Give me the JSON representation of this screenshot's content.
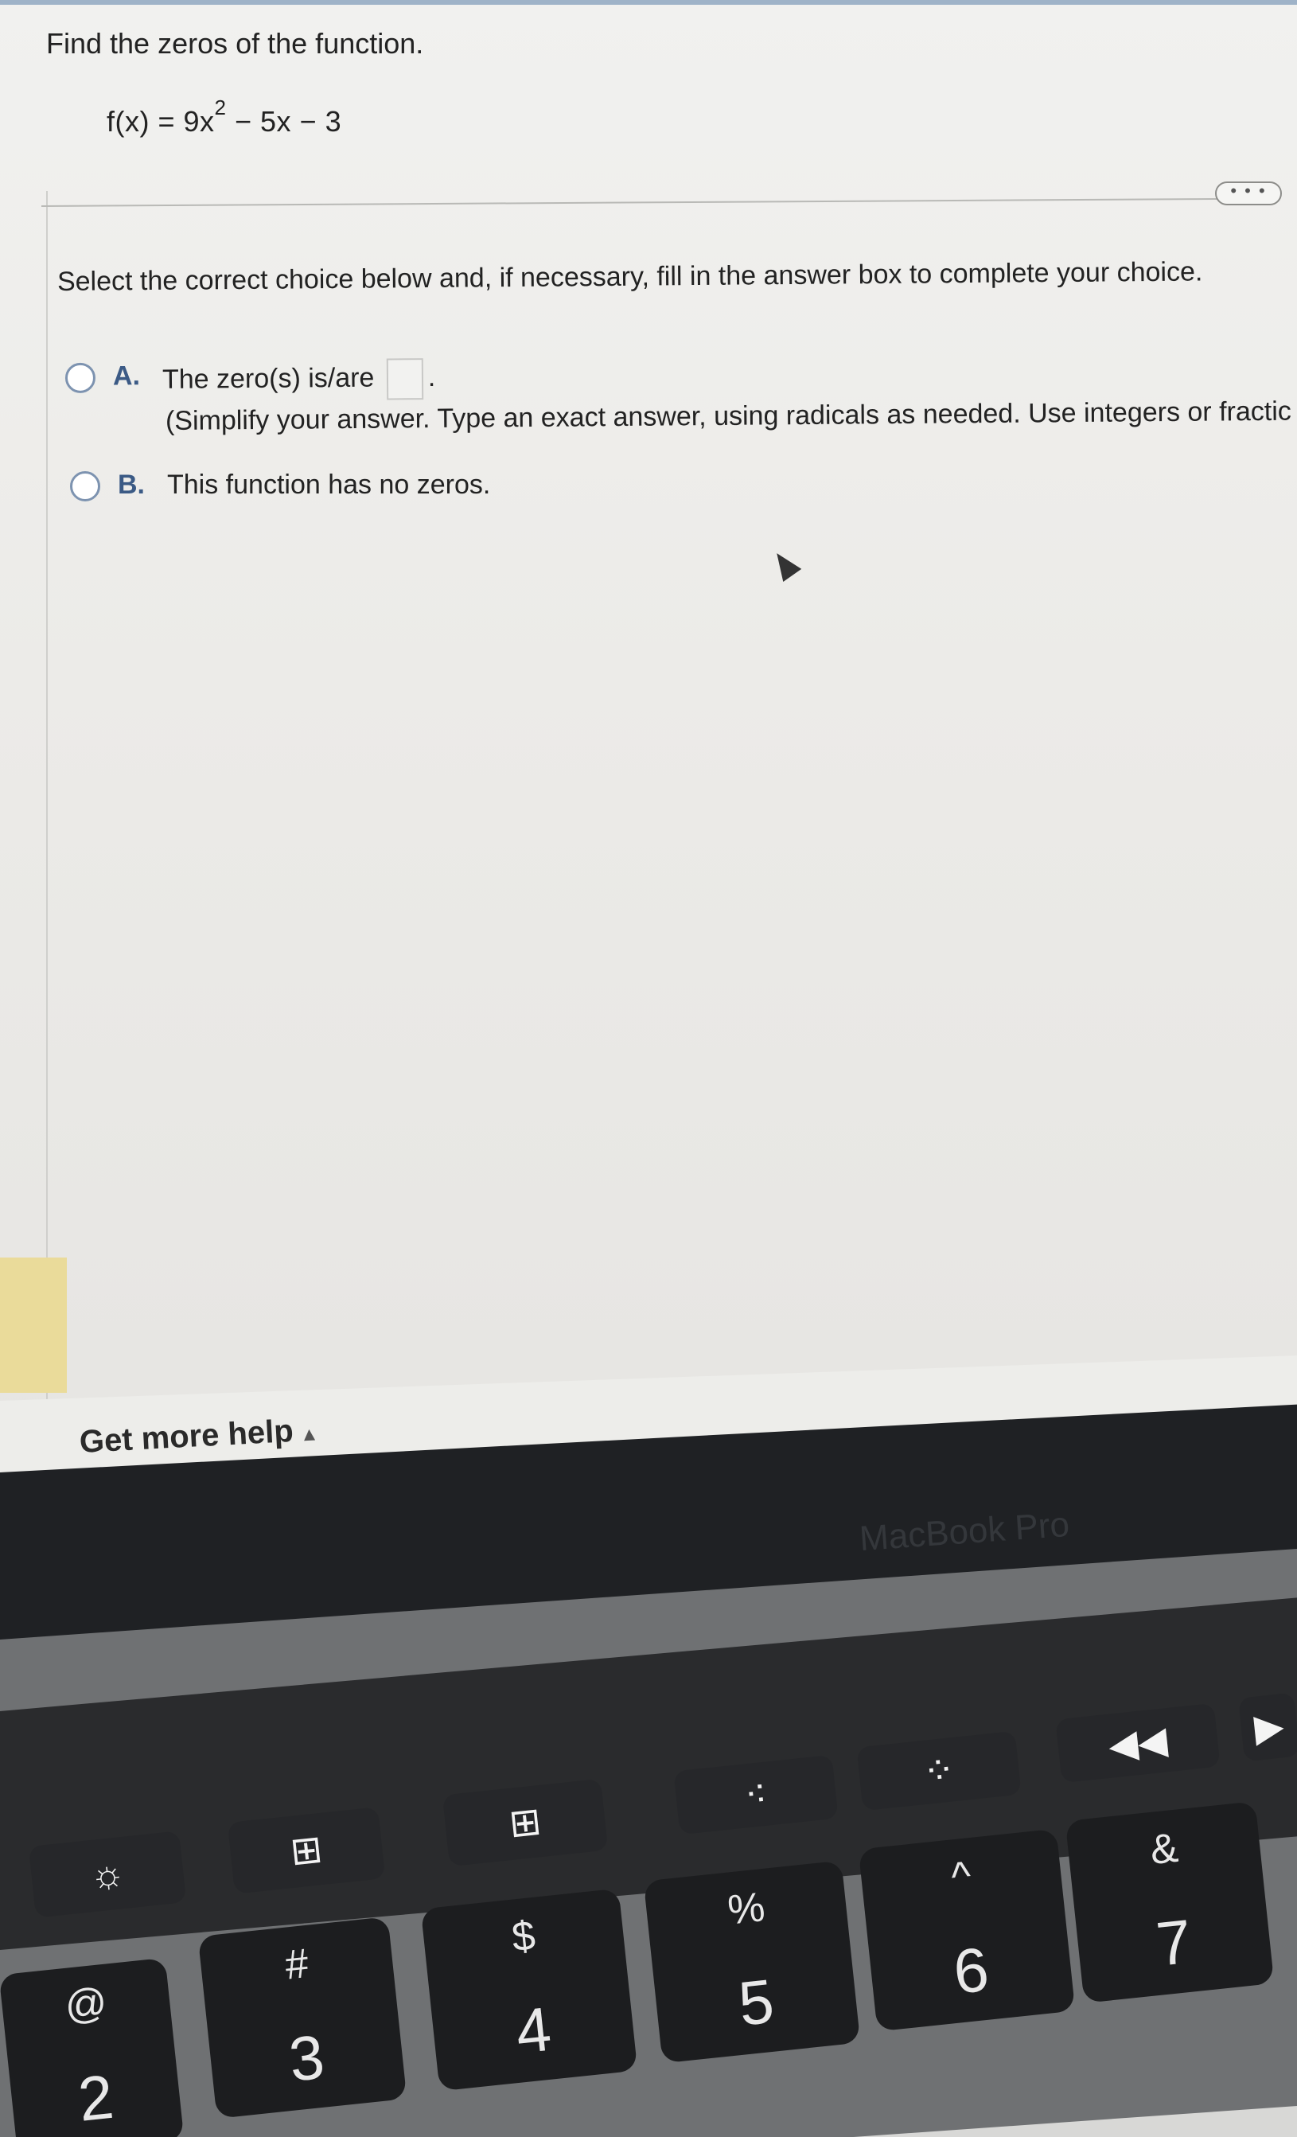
{
  "question": {
    "title": "Find the zeros of the function.",
    "equation_lhs": "f(x) = 9x",
    "equation_exp": "2",
    "equation_rhs": " − 5x − 3",
    "more_button": "• • •"
  },
  "instruction": "Select the correct choice below and, if necessary, fill in the answer box to complete your choice.",
  "choices": [
    {
      "letter": "A.",
      "text": "The zero(s) is/are",
      "suffix": ".",
      "hint": "(Simplify your answer. Type an exact answer, using radicals as needed. Use integers or fractic"
    },
    {
      "letter": "B.",
      "text": "This function has no zeros."
    }
  ],
  "help": {
    "label": "Get more help",
    "arrow": "▲"
  },
  "laptop": {
    "brand": "MacBook Pro",
    "touchbar_keys": [
      "☼",
      "⊞",
      "⊞",
      "⁖",
      "⁘",
      "◀◀",
      "▶"
    ],
    "keys": [
      {
        "top": "@",
        "bottom": "2"
      },
      {
        "top": "#",
        "bottom": "3"
      },
      {
        "top": "$",
        "bottom": "4"
      },
      {
        "top": "%",
        "bottom": "5"
      },
      {
        "top": "^",
        "bottom": "6"
      },
      {
        "top": "&",
        "bottom": "7"
      }
    ]
  }
}
